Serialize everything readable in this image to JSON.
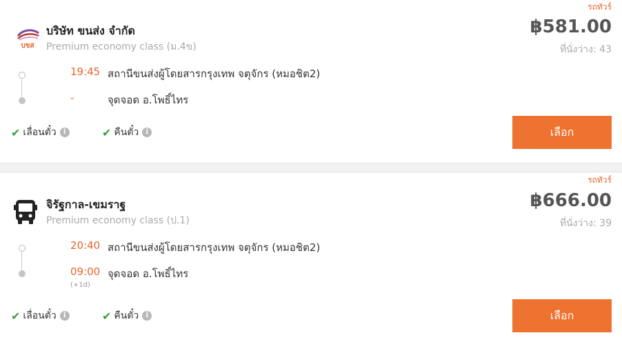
{
  "results": [
    {
      "type_badge": "รถทัวร์",
      "logo_text": "บขส",
      "company": "บริษัท ขนส่ง จำกัด",
      "class": "Premium economy class (ม.4ข)",
      "price": "฿581.00",
      "seats": "ที่นั่งว่าง: 43",
      "departure": {
        "time": "19:45",
        "place": "สถานีขนส่งผู้โดยสารกรุงเทพ จตุจักร (หมอชิต2)"
      },
      "arrival": {
        "time": "-",
        "place": "จุดจอด อ.โพธิ์ไทร",
        "day_offset": ""
      },
      "features": [
        "เลื่อนตั๋ว",
        "คืนตั๋ว"
      ],
      "button": "เลือก"
    },
    {
      "type_badge": "รถทัวร์",
      "logo_text": "",
      "company": "จิรัฐกาล-เขมราฐ",
      "class": "Premium economy class (ป.1)",
      "price": "฿666.00",
      "seats": "ที่นั่งว่าง: 39",
      "departure": {
        "time": "20:40",
        "place": "สถานีขนส่งผู้โดยสารกรุงเทพ จตุจักร (หมอชิต2)"
      },
      "arrival": {
        "time": "09:00",
        "place": "จุดจอด อ.โพธิ์ไทร",
        "day_offset": "(+1d)"
      },
      "features": [
        "เลื่อนตั๋ว",
        "คืนตั๋ว"
      ],
      "button": "เลือก"
    }
  ],
  "colors": {
    "accent": "#ee7230",
    "time": "#e8652b",
    "check": "#3d9a3d",
    "price": "#555555"
  }
}
